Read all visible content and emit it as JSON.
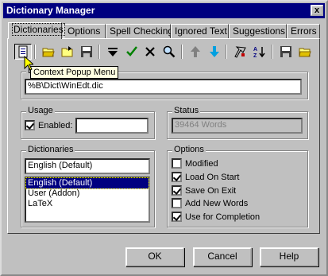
{
  "window": {
    "title": "Dictionary Manager",
    "close_glyph": "x"
  },
  "tabs": [
    {
      "label": "Dictionaries",
      "active": true
    },
    {
      "label": "Options"
    },
    {
      "label": "Spell Checking"
    },
    {
      "label": "Ignored Text"
    },
    {
      "label": "Suggestions"
    },
    {
      "label": "Errors"
    }
  ],
  "toolbar": {
    "icons": [
      "context-menu-icon",
      "open-folder-icon",
      "open-file-icon",
      "save-icon",
      "dropdown-triangle-icon",
      "checkmark-icon",
      "delete-x-icon",
      "magnifier-icon",
      "arrow-up-icon",
      "arrow-down-icon",
      "tools-icon",
      "sort-az-icon",
      "floppy-save-icon",
      "folder-open-icon"
    ],
    "tooltip": "Context Popup Menu"
  },
  "file_group": {
    "label": "D",
    "path": "%B\\Dict\\WinEdt.dic"
  },
  "usage": {
    "label": "Usage",
    "enabled_label": "Enabled:",
    "enabled": true,
    "value": ""
  },
  "status": {
    "label": "Status",
    "value": "39464 Words"
  },
  "dictionaries": {
    "label": "Dictionaries",
    "current": "English (Default)",
    "items": [
      "English (Default)",
      "User (Addon)",
      "LaTeX"
    ],
    "selected_index": 0
  },
  "options": {
    "label": "Options",
    "items": [
      {
        "label": "Modified",
        "checked": false
      },
      {
        "label": "Load On Start",
        "checked": true
      },
      {
        "label": "Save On Exit",
        "checked": true
      },
      {
        "label": "Add New Words",
        "checked": false
      },
      {
        "label": "Use for Completion",
        "checked": true
      }
    ]
  },
  "buttons": {
    "ok": "OK",
    "cancel": "Cancel",
    "help": "Help"
  },
  "colors": {
    "titlebar": "#000080",
    "face": "#c0c0c0",
    "selection": "#000080",
    "tooltip": "#ffffe1"
  }
}
